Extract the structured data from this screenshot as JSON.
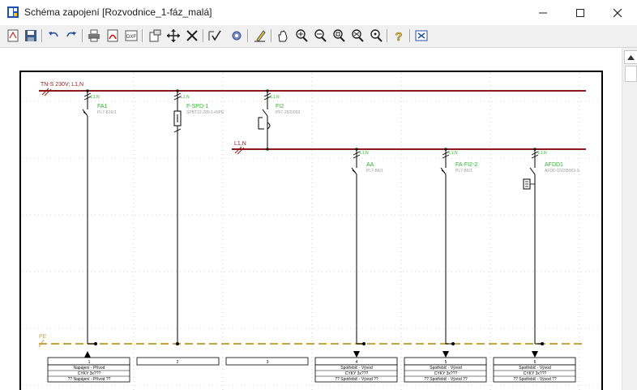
{
  "window": {
    "title": "Schéma zapojení [Rozvodnice_1-fáz_malá]",
    "controls": [
      "minimize",
      "maximize",
      "close"
    ]
  },
  "toolbar": {
    "buttons": [
      "new-icon",
      "save-icon",
      "undo-icon",
      "redo-icon",
      "print-icon",
      "pdf-icon",
      "dxf-icon",
      "properties-icon",
      "move-icon",
      "delete-icon",
      "check-icon",
      "settings-icon",
      "pen-icon",
      "hand-icon",
      "zoom-in-icon",
      "zoom-out-icon",
      "zoom-window-icon",
      "zoom-all-icon",
      "zoom-fit-icon",
      "help-icon",
      "close-doc-icon"
    ],
    "labels": {
      "pdf": "PDF",
      "dxf": "DXF"
    }
  },
  "colors": {
    "bus": "#8b1a1a",
    "label_green": "#2db52d",
    "pe": "#c8a53a",
    "wire": "#000000"
  },
  "schematic": {
    "main_bus_label": "TN-S 230V; L1,N",
    "sub_bus_label": "L1,N",
    "pe_label": "PE",
    "top_devices": [
      {
        "phase": "L1,N",
        "name": "FA1",
        "type": "PL7-B16/1"
      },
      {
        "phase": "L1,N",
        "name": "F-SPD-1",
        "type": "SPBT12-280-1+NPE"
      },
      {
        "phase": "L1,N",
        "name": "FI2",
        "type": "PF7-25/2/003"
      }
    ],
    "sub_devices": [
      {
        "phase": "L1,N",
        "name": "AA",
        "type": "PL7-B6/1"
      },
      {
        "phase": "L1,N",
        "name": "FA-FI2-2",
        "type": "PL7-B6/1"
      },
      {
        "phase": "L1,N",
        "name": "AFDD1",
        "type": "AFDD-10/2/B003-S"
      }
    ],
    "terminals": [
      {
        "num": "1",
        "line1": "Napájení - Přívod",
        "line2": "CYKY 3x???",
        "line3": "?? Napájení - Přívod ??"
      },
      {
        "num": "2",
        "line1": "",
        "line2": "",
        "line3": ""
      },
      {
        "num": "3",
        "line1": "",
        "line2": "",
        "line3": ""
      },
      {
        "num": "4",
        "line1": "Spotřebič - Vývod",
        "line2": "CYKY 3x???",
        "line3": "?? Spotřebič - Vývod ??"
      },
      {
        "num": "5",
        "line1": "Spotřebič - Vývod",
        "line2": "CYKY 3x???",
        "line3": "?? Spotřebič - Vývod ??"
      },
      {
        "num": "6",
        "line1": "Spotřebič - Vývod",
        "line2": "CYKY 3x???",
        "line3": "?? Spotřebič - Vývod ??"
      }
    ]
  }
}
